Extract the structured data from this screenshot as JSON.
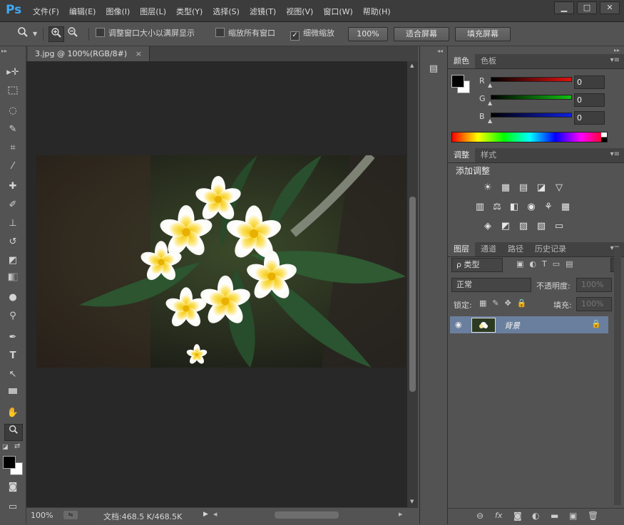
{
  "app": {
    "logo": "Ps"
  },
  "menu": [
    "文件(F)",
    "编辑(E)",
    "图像(I)",
    "图层(L)",
    "类型(Y)",
    "选择(S)",
    "滤镜(T)",
    "视图(V)",
    "窗口(W)",
    "帮助(H)"
  ],
  "window_controls": {
    "minimize": "▁",
    "maximize": "□",
    "close": "✕"
  },
  "options": {
    "resize_windows": {
      "label": "调整窗口大小以满屏显示",
      "checked": false
    },
    "zoom_all": {
      "label": "缩放所有窗口",
      "checked": false
    },
    "scrubby_zoom": {
      "label": "细微缩放",
      "checked": true
    },
    "btn_100": "100%",
    "btn_fit": "适合屏幕",
    "btn_fill": "填充屏幕"
  },
  "document": {
    "tab_title": "3.jpg @ 100%(RGB/8#)",
    "tab_close": "×",
    "zoom": "100%",
    "doc_size": "文档:468.5 K/468.5K"
  },
  "color_panel": {
    "tabs": [
      "颜色",
      "色板"
    ],
    "channels": [
      {
        "label": "R",
        "value": "0",
        "color": "#e01010"
      },
      {
        "label": "G",
        "value": "0",
        "color": "#10c010"
      },
      {
        "label": "B",
        "value": "0",
        "color": "#1020e0"
      }
    ]
  },
  "adjust_panel": {
    "tabs": [
      "调整",
      "样式"
    ],
    "title": "添加调整",
    "icons_row1": [
      "☀",
      "▦",
      "▤",
      "◪",
      "▽"
    ],
    "icons_row2": [
      "▥",
      "⚖",
      "◧",
      "◉",
      "⚘",
      "▦"
    ],
    "icons_row3": [
      "◈",
      "◩",
      "▨",
      "▧",
      "▭"
    ]
  },
  "layers_panel": {
    "tabs": [
      "图层",
      "通道",
      "路径",
      "历史记录"
    ],
    "filter_label": "ρ 类型",
    "blend_mode": "正常",
    "opacity_label": "不透明度:",
    "opacity_value": "100%",
    "lock_label": "锁定:",
    "fill_label": "填充:",
    "fill_value": "100%",
    "layer_name": "背景"
  },
  "colors": {
    "accent": "#3fa9f5",
    "layer_selected": "#6a7f9e"
  }
}
